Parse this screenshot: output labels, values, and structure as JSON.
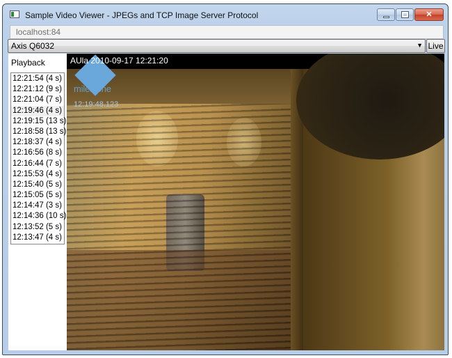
{
  "window": {
    "title": "Sample Video Viewer - JPEGs and TCP Image Server Protocol",
    "controls": {
      "minimize": "minimize",
      "maximize": "maximize",
      "close": "✕"
    }
  },
  "server": {
    "value": "localhost:84"
  },
  "camera": {
    "selected": "Axis Q6032",
    "arrow": "▼"
  },
  "live_button": "Live",
  "playback": {
    "label": "Playback",
    "recordings": [
      "12:21:54 (4 s)",
      "12:21:12 (9 s)",
      "12:21:04 (7 s)",
      "12:19:46 (4 s)",
      "12:19:15 (13 s)",
      "12:18:58 (13 s)",
      "12:18:37 (4 s)",
      "12:16:56 (8 s)",
      "12:16:44 (7 s)",
      "12:15:53 (4 s)",
      "12:15:40 (5 s)",
      "12:15:05 (5 s)",
      "12:14:47 (3 s)",
      "12:14:36 (10 s)",
      "12:13:52 (5 s)",
      "12:13:47 (4 s)"
    ]
  },
  "video": {
    "caption": "AUla 2010-09-17 12:21:20",
    "overlay_logo_text": "milestone",
    "overlay_timestamp": "12:19:48.123"
  }
}
